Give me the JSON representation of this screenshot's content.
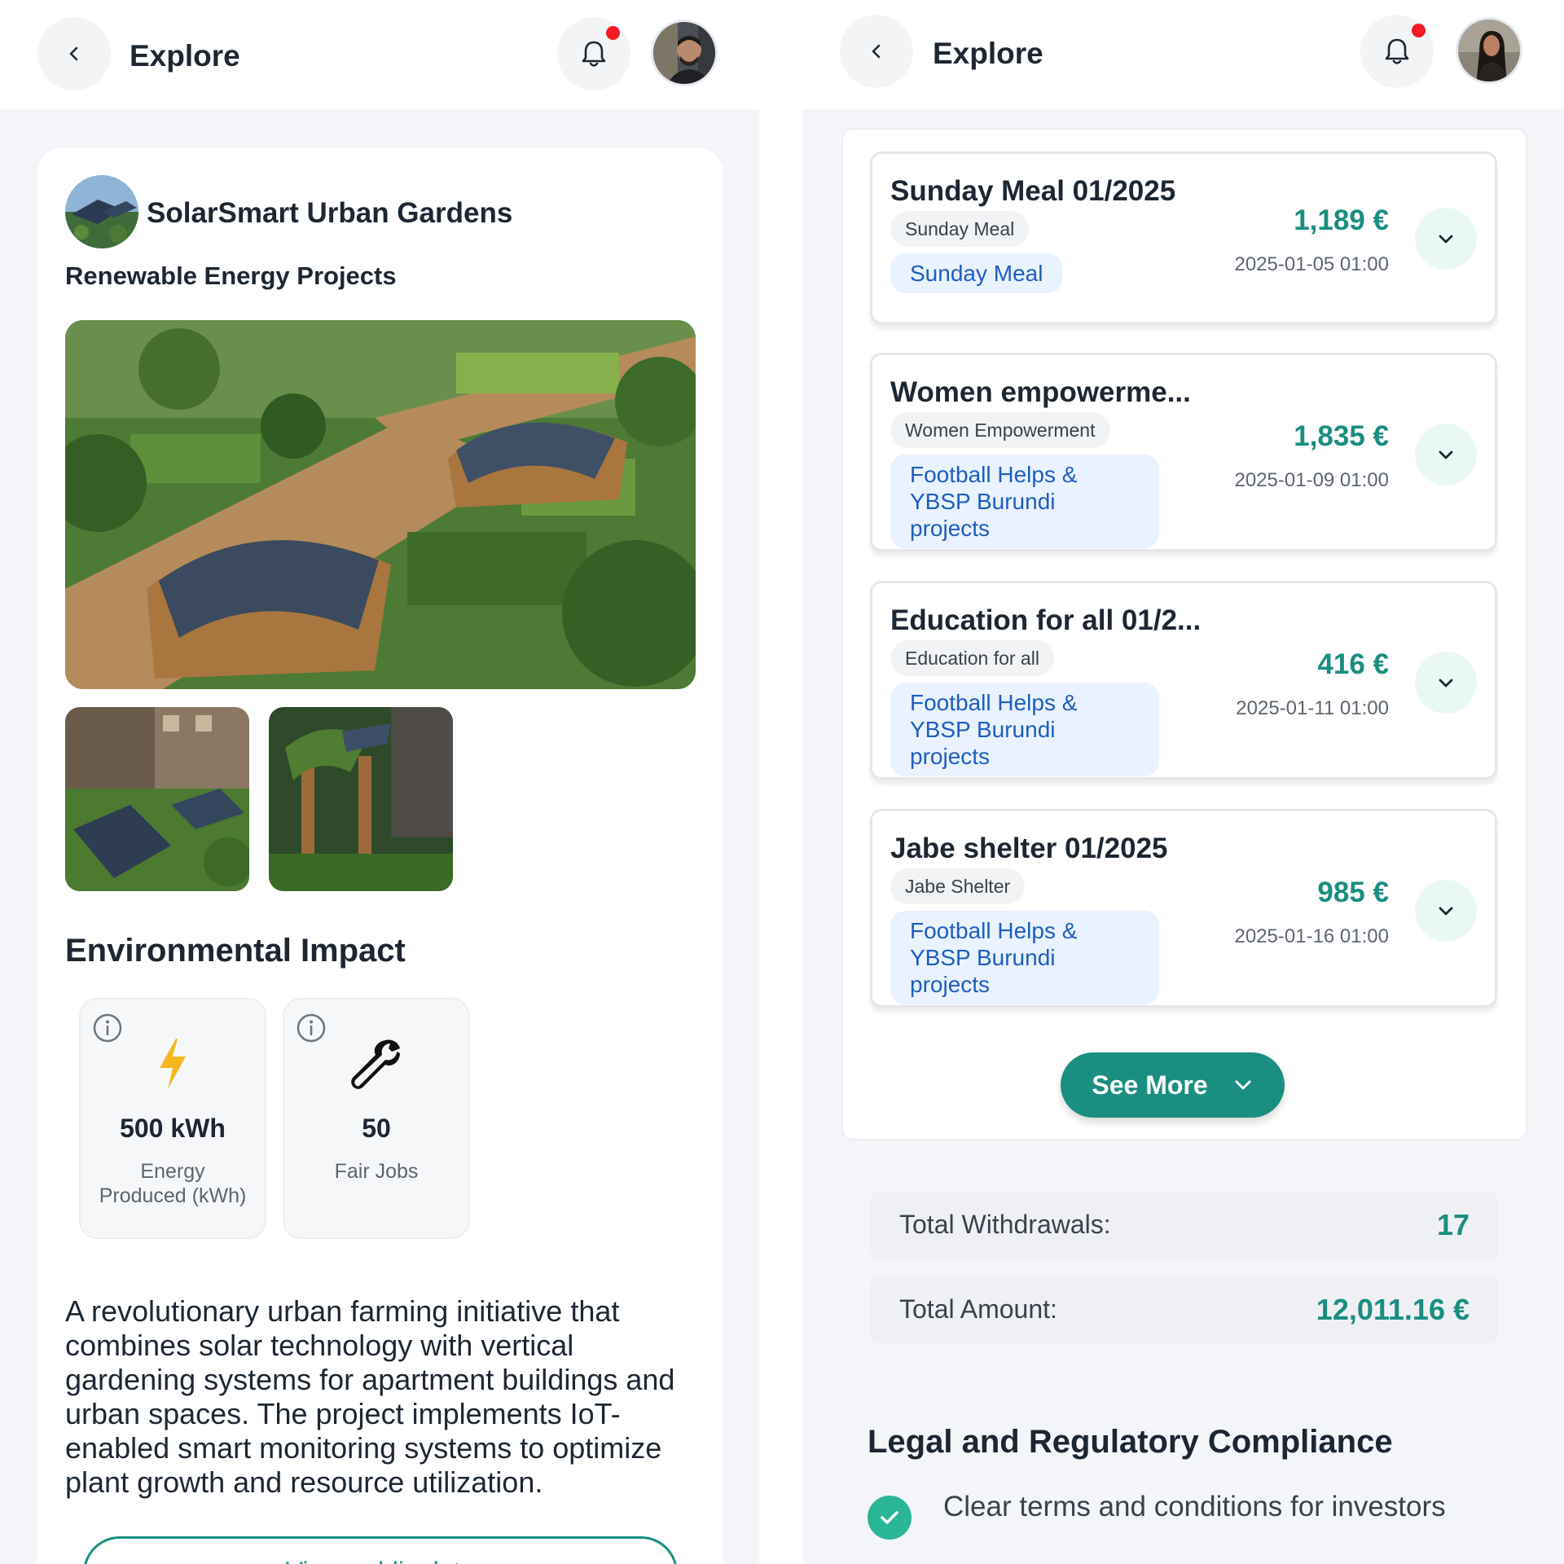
{
  "left": {
    "header": {
      "title": "Explore"
    },
    "project": {
      "title": "SolarSmart Urban Gardens",
      "category": "Renewable Energy Projects",
      "impact_title": "Environmental Impact",
      "metrics": [
        {
          "icon": "lightning-bolt-icon",
          "value": "500 kWh",
          "label": "Energy Produced (kWh)"
        },
        {
          "icon": "wrench-icon",
          "value": "50",
          "label": "Fair Jobs"
        }
      ],
      "description": "A revolutionary urban farming initiative that combines solar technology with vertical gardening systems for apartment buildings and urban spaces. The project implements IoT-enabled smart monitoring systems to optimize plant growth and resource utilization.",
      "cta_label": "View public data"
    }
  },
  "right": {
    "header": {
      "title": "Explore"
    },
    "withdrawals": [
      {
        "title": "Sunday Meal 01/2025",
        "pill": "Sunday Meal",
        "project": "Sunday Meal",
        "amount": "1,189 €",
        "date": "2025-01-05 01:00"
      },
      {
        "title": "Women empowerme...",
        "pill": "Women Empowerment",
        "project": "Football Helps & YBSP Burundi projects",
        "amount": "1,835 €",
        "date": "2025-01-09 01:00"
      },
      {
        "title": "Education for all 01/2...",
        "pill": "Education for all",
        "project": "Football Helps & YBSP Burundi projects",
        "amount": "416 €",
        "date": "2025-01-11 01:00"
      },
      {
        "title": "Jabe shelter 01/2025",
        "pill": "Jabe Shelter",
        "project": "Football Helps & YBSP Burundi projects",
        "amount": "985 €",
        "date": "2025-01-16 01:00"
      }
    ],
    "see_more_label": "See More",
    "summary": [
      {
        "label": "Total Withdrawals:",
        "value": "17"
      },
      {
        "label": "Total Amount:",
        "value": "12,011.16 €"
      }
    ],
    "legal": {
      "title": "Legal and Regulatory Compliance",
      "items": [
        "Clear terms and conditions for investors"
      ]
    }
  },
  "colors": {
    "accent": "#1a8e80",
    "link_blue": "#1d5fbf",
    "notification": "#f21b24",
    "bolt": "#f5b81f"
  }
}
